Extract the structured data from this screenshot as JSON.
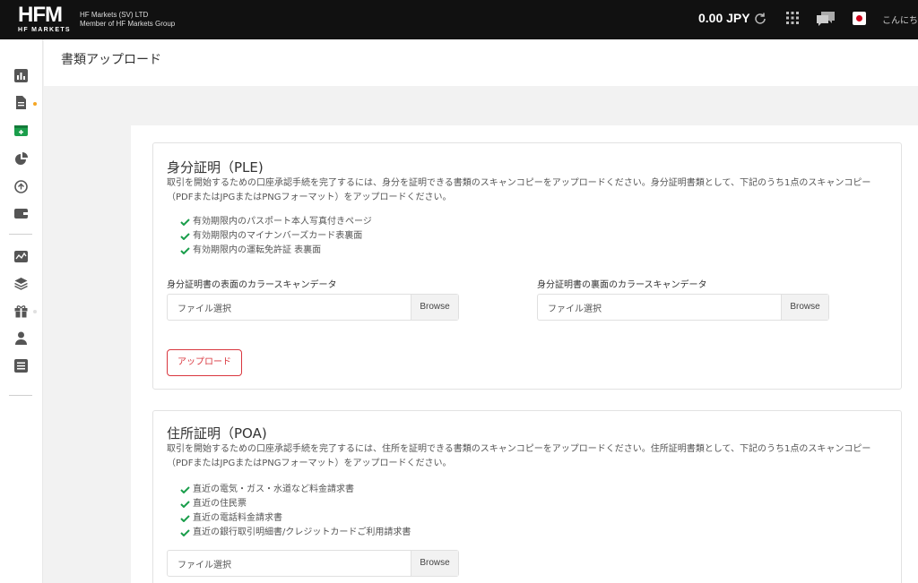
{
  "header": {
    "logo_main": "HFM",
    "logo_sub": "HF MARKETS",
    "company_line1": "HF Markets (SV) LTD",
    "company_line2": "Member of HF Markets Group",
    "balance": "0.00 JPY",
    "greeting": "こんにち"
  },
  "page": {
    "title": "書類アップロード"
  },
  "sidebar": {
    "icons": [
      "bar-chart-icon",
      "document-icon",
      "wallet-add-icon",
      "pie-chart-icon",
      "transfer-icon",
      "wallet-icon",
      "line-chart-icon",
      "layers-icon",
      "gift-icon",
      "user-icon",
      "list-icon"
    ],
    "active_color": "#1a9e4b",
    "dot_color": "#f5a623"
  },
  "ple": {
    "title": "身分証明（PLE)",
    "description": "取引を開始するための口座承認手続を完了するには、身分を証明できる書類のスキャンコピーをアップロードください。身分証明書類として、下記のうち1点のスキャンコピー（PDFまたはJPGまたはPNGフォーマット）をアップロードください。",
    "items": [
      "有効期限内のパスポート本人写真付きページ",
      "有効期限内のマイナンバーズカード表裏面",
      "有効期限内の運転免許証 表裏面"
    ],
    "front_label": "身分証明書の表面のカラースキャンデータ",
    "back_label": "身分証明書の裏面のカラースキャンデータ",
    "front_placeholder": "ファイル選択",
    "back_placeholder": "ファイル選択",
    "browse": "Browse",
    "upload": "アップロード"
  },
  "poa": {
    "title": "住所証明（POA)",
    "description": "取引を開始するための口座承認手続を完了するには、住所を証明できる書類のスキャンコピーをアップロードください。住所証明書類として、下記のうち1点のスキャンコピー（PDFまたはJPGまたはPNGフォーマット）をアップロードください。",
    "items": [
      "直近の電気・ガス・水道など料金請求書",
      "直近の住民票",
      "直近の電話料金請求書",
      "直近の銀行取引明細書/クレジットカードご利用請求書"
    ],
    "placeholder": "ファイル選択",
    "browse": "Browse"
  },
  "colors": {
    "check": "#1a9e4b",
    "accent_red": "#d9363e"
  }
}
